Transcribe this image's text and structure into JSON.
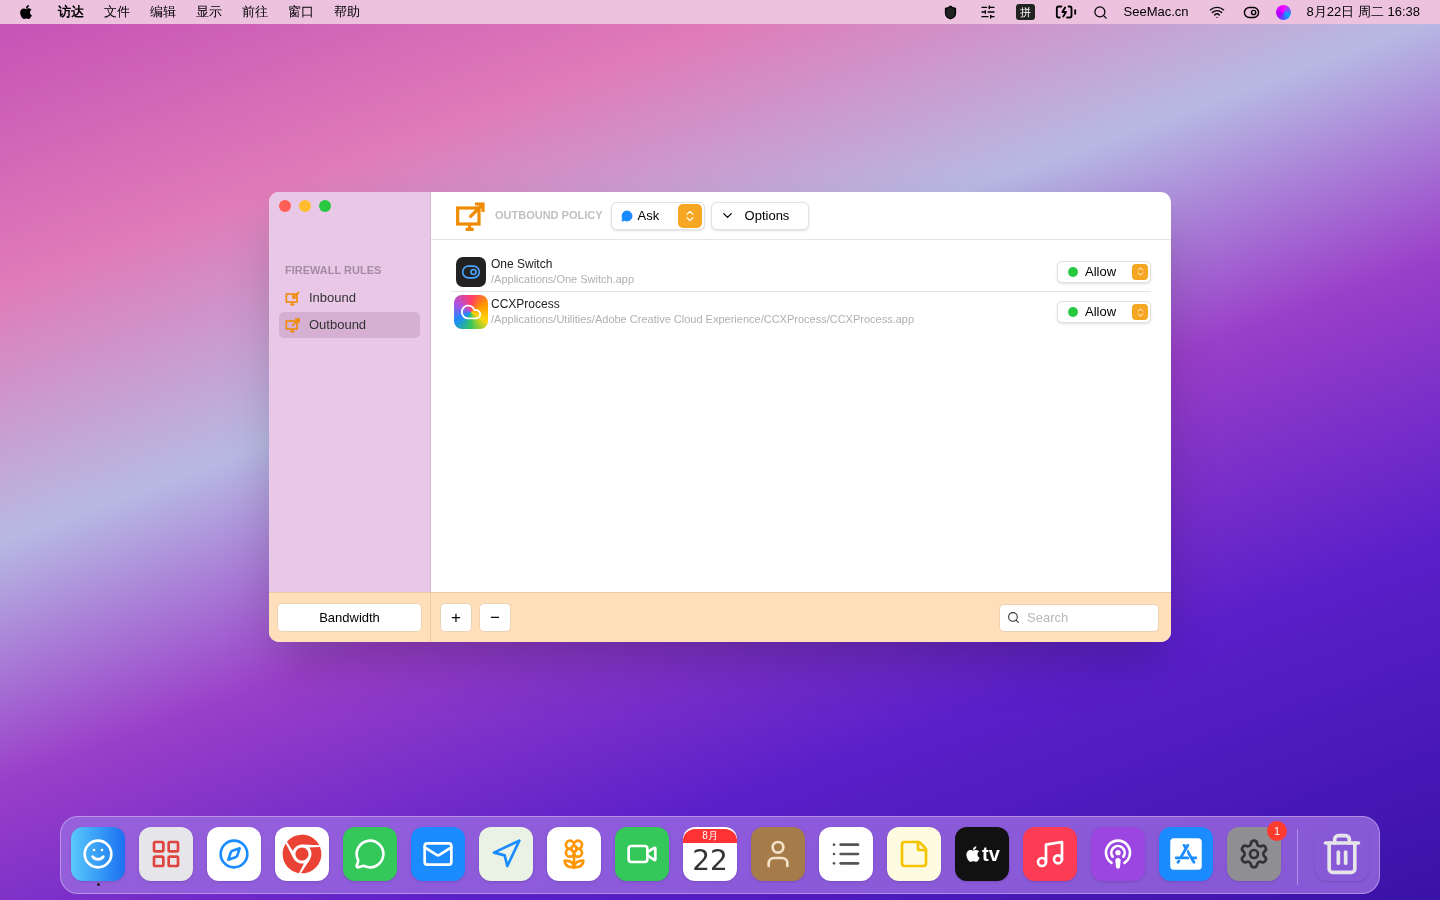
{
  "menubar": {
    "menus": [
      "访达",
      "文件",
      "编辑",
      "显示",
      "前往",
      "窗口",
      "帮助"
    ],
    "input_method": "拼",
    "site": "SeeMac.cn",
    "clock": "8月22日 周二 16:38"
  },
  "window": {
    "sidebar": {
      "section": "FIREWALL RULES",
      "items": [
        {
          "label": "Inbound",
          "kind": "inbound",
          "selected": false
        },
        {
          "label": "Outbound",
          "kind": "outbound",
          "selected": true
        }
      ],
      "bandwidth_button": "Bandwidth"
    },
    "toolbar": {
      "policy_label": "OUTBOUND POLICY",
      "policy": "Ask",
      "options": "Options"
    },
    "rules": [
      {
        "name": "One Switch",
        "path": "/Applications/One Switch.app",
        "kind": "switch",
        "action": "Allow",
        "color": "#28c840"
      },
      {
        "name": "CCXProcess",
        "path": "/Applications/Utilities/Adobe Creative Cloud Experience/CCXProcess/CCXProcess.app",
        "kind": "cloud",
        "action": "Allow",
        "color": "#28c840"
      }
    ],
    "footer": {
      "add": "+",
      "remove": "−",
      "search": {
        "placeholder": "Search"
      }
    }
  },
  "dock": {
    "items": [
      {
        "kind": "finder",
        "running": true
      },
      {
        "kind": "launchpad",
        "running": false
      },
      {
        "kind": "safari",
        "running": false
      },
      {
        "kind": "chrome",
        "running": false
      },
      {
        "kind": "messages",
        "running": false
      },
      {
        "kind": "mail",
        "running": false
      },
      {
        "kind": "maps",
        "running": false
      },
      {
        "kind": "photos",
        "running": false
      },
      {
        "kind": "facetime",
        "running": false
      },
      {
        "kind": "calendar",
        "running": false,
        "month": "8月",
        "day": "22"
      },
      {
        "kind": "contacts",
        "running": false
      },
      {
        "kind": "reminders",
        "running": false
      },
      {
        "kind": "notes",
        "running": false
      },
      {
        "kind": "tv",
        "running": false,
        "label": "tv"
      },
      {
        "kind": "music",
        "running": false
      },
      {
        "kind": "podcasts",
        "running": false
      },
      {
        "kind": "appstore",
        "running": false
      },
      {
        "kind": "settings",
        "running": false,
        "badge": "1"
      },
      {
        "kind": "trash",
        "running": false
      }
    ]
  }
}
